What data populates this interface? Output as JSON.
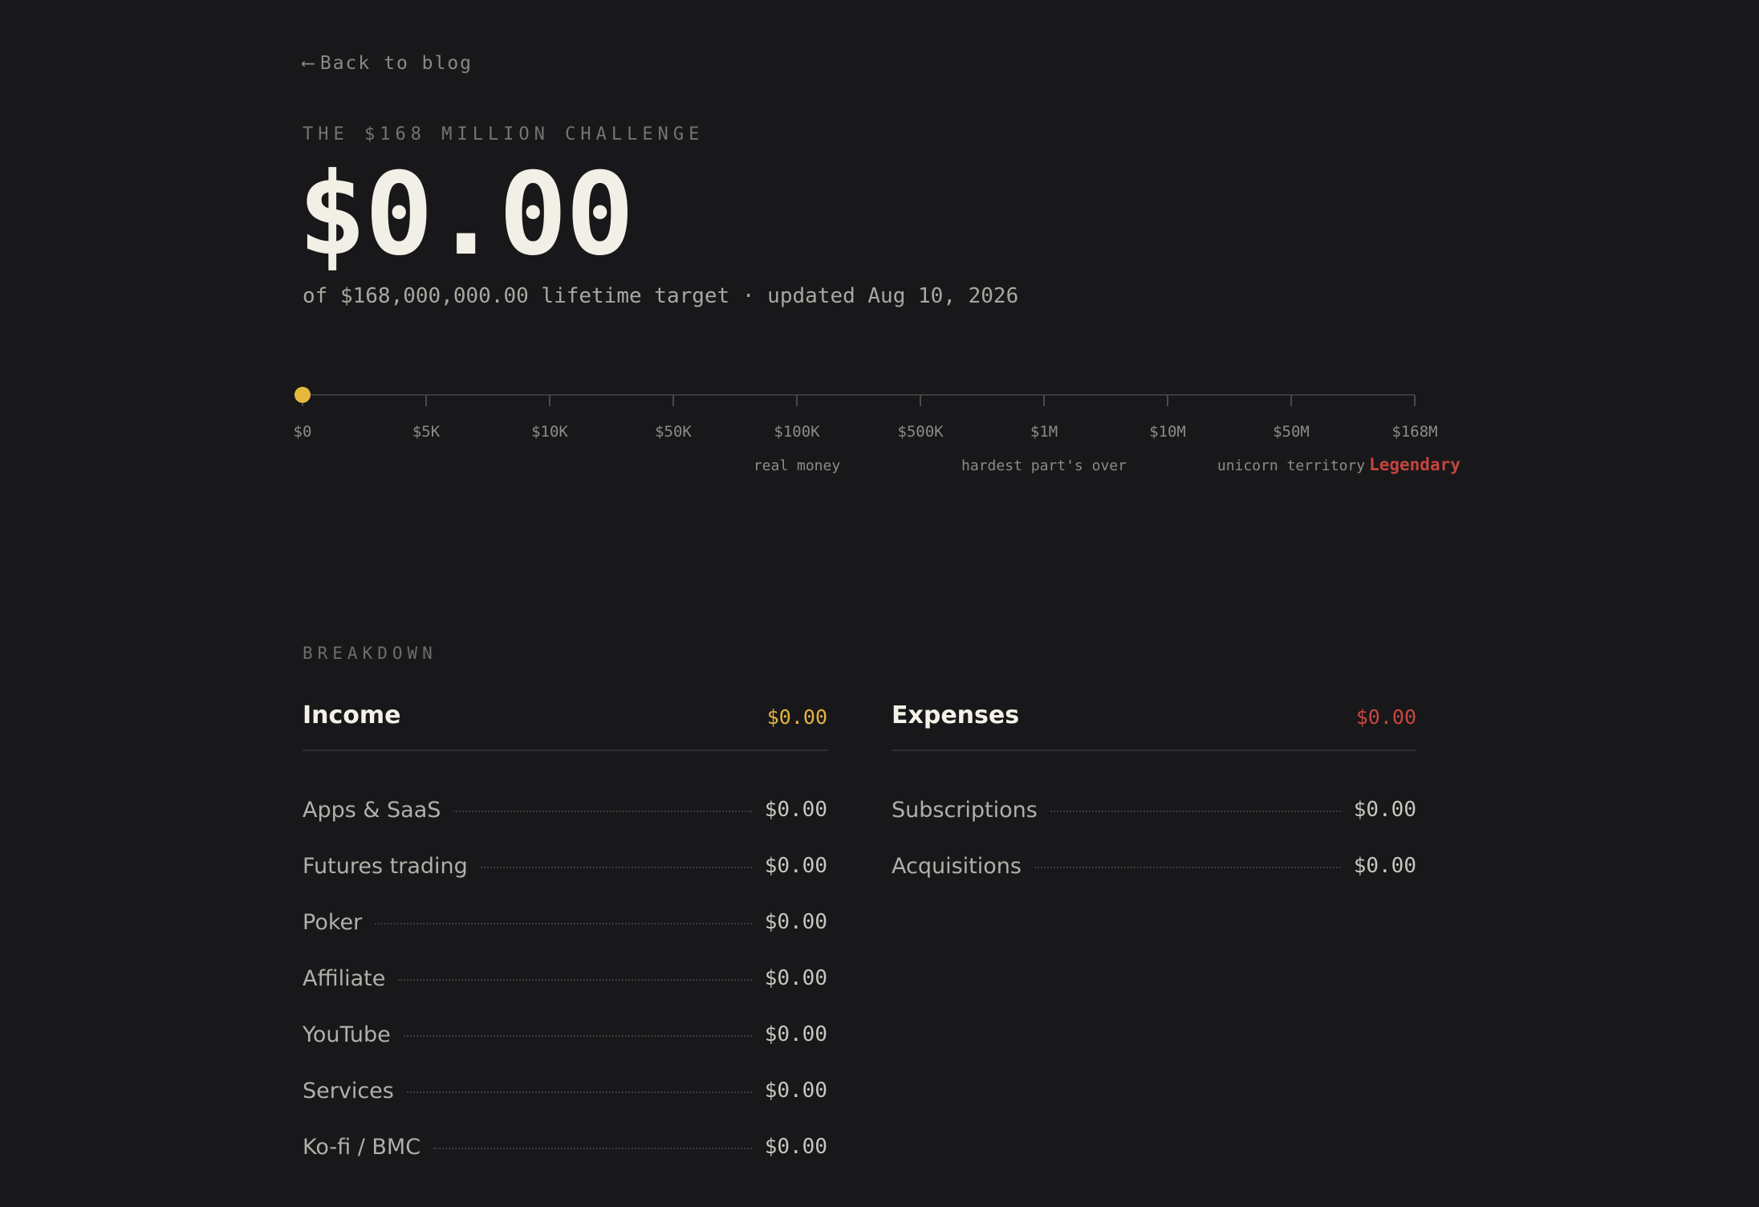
{
  "back_link": {
    "arrow": "⟵",
    "label": "Back to blog"
  },
  "hero": {
    "eyebrow": "THE $168 MILLION CHALLENGE",
    "amount": "$0.00",
    "subline": "of $168,000,000.00 lifetime target · updated Aug 10, 2026"
  },
  "progress": {
    "current_value": 0,
    "milestones": [
      {
        "label": "$0",
        "value": 0,
        "note": ""
      },
      {
        "label": "$5K",
        "value": 5000,
        "note": ""
      },
      {
        "label": "$10K",
        "value": 10000,
        "note": ""
      },
      {
        "label": "$50K",
        "value": 50000,
        "note": ""
      },
      {
        "label": "$100K",
        "value": 100000,
        "note": "real money"
      },
      {
        "label": "$500K",
        "value": 500000,
        "note": ""
      },
      {
        "label": "$1M",
        "value": 1000000,
        "note": "hardest part's over"
      },
      {
        "label": "$10M",
        "value": 10000000,
        "note": ""
      },
      {
        "label": "$50M",
        "value": 50000000,
        "note": "unicorn territory"
      },
      {
        "label": "$168M",
        "value": 168000000,
        "note": "Legendary"
      }
    ],
    "colors": {
      "marker": "#e6b93e",
      "track": "#3a3a3d",
      "tick_label": "#8d8b85",
      "note": "#8d8b85",
      "legendary": "#c4443f"
    }
  },
  "breakdown": {
    "label": "BREAKDOWN",
    "income": {
      "title": "Income",
      "total": "$0.00",
      "total_color": "#e3b341",
      "items": [
        {
          "label": "Apps & SaaS",
          "value": "$0.00"
        },
        {
          "label": "Futures trading",
          "value": "$0.00"
        },
        {
          "label": "Poker",
          "value": "$0.00"
        },
        {
          "label": "Affiliate",
          "value": "$0.00"
        },
        {
          "label": "YouTube",
          "value": "$0.00"
        },
        {
          "label": "Services",
          "value": "$0.00"
        },
        {
          "label": "Ko-fi / BMC",
          "value": "$0.00"
        }
      ]
    },
    "expenses": {
      "title": "Expenses",
      "total": "$0.00",
      "total_color": "#c9463f",
      "items": [
        {
          "label": "Subscriptions",
          "value": "$0.00"
        },
        {
          "label": "Acquisitions",
          "value": "$0.00"
        }
      ]
    }
  }
}
